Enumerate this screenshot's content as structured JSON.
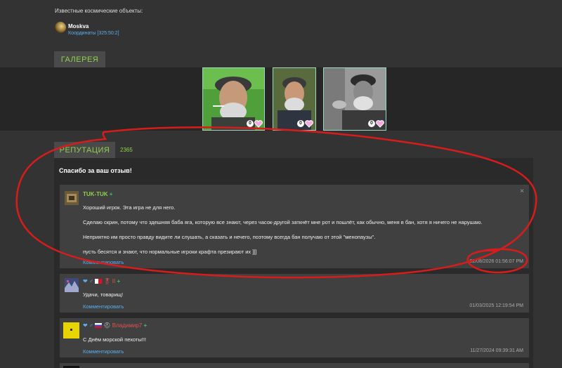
{
  "space": {
    "label": "Известные космические объекты:",
    "object": {
      "name": "Moskva",
      "coords": "Координаты [325:50:2]"
    }
  },
  "gallery": {
    "tab_label": "ГАЛЕРЕЯ",
    "photos": [
      {
        "alt": "photo-1",
        "count": "0"
      },
      {
        "alt": "photo-2",
        "count": "0"
      },
      {
        "alt": "photo-3",
        "count": "0"
      }
    ]
  },
  "reputation": {
    "tab_label": "РЕПУТАЦИЯ",
    "count": "2365",
    "thanks": "Спасибо за ваш отзыв!",
    "comment_link": "Комментировать",
    "close": "×",
    "reviews": [
      {
        "author": "TUK-TUK",
        "plus": "+",
        "lines": [
          "Хороший игрок. Эта игра не для него.",
          "Сделаю скрин, потому что здешняя баба яга, которую все знают, через часок-другой заткнёт мне рот и пошлёт, как обычно, меня в бан, хотя я ничего не нарушаю.",
          "Неприятно им просто правду видите ли слушать, а сказать и нечего, поэтому всегда бан получаю от этой \"менопаузы\".",
          "пусть бесятся и знают, что нормальные игроки крафта презирают их ]]]"
        ],
        "date": "02/08/2026 01:56:07 PM"
      },
      {
        "author_icons": "❤ ♂",
        "author_suffix": "II",
        "plus": "+",
        "lines": [
          "Удачи, товарищ!"
        ],
        "date": "01/03/2025 12:19:54 PM"
      },
      {
        "author_icons": "❤ ♂",
        "author": "Владимир7",
        "plus": "+",
        "lines": [
          "С Днём морской пехоты!!!"
        ],
        "date": "11/27/2024 09:39:31 AM"
      }
    ]
  },
  "colors": {
    "accent_green": "#8fd14a",
    "link_blue": "#5aaef0",
    "annotation_red": "#d81c1c"
  }
}
